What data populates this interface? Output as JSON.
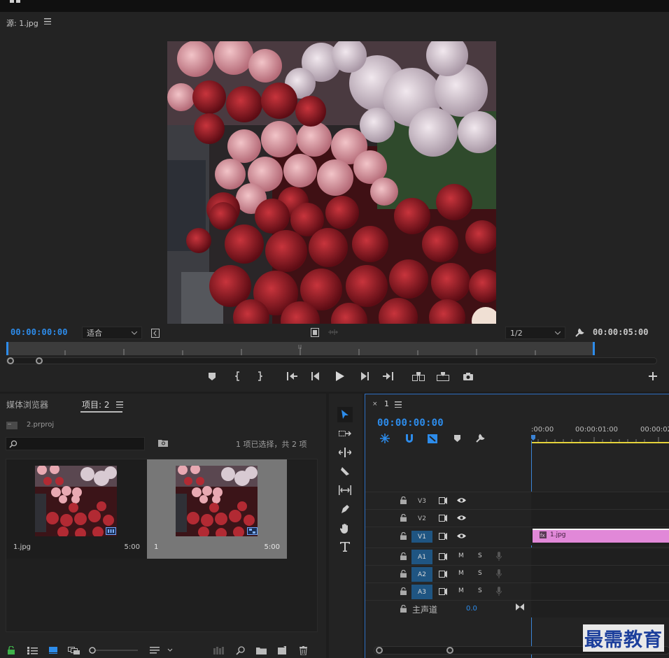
{
  "colors": {
    "accent": "#2d8ceb",
    "clip_pink": "#e188d8",
    "panel_bg": "#232323",
    "active_track": "#1f5582"
  },
  "source": {
    "title": "源: 1.jpg",
    "timecode": "00:00:00:00",
    "fit": "适合",
    "resolution": "1/2",
    "duration": "00:00:05:00",
    "image": "flower-market-photo"
  },
  "project": {
    "tab_media_browser": "媒体浏览器",
    "tab_project": "项目: 2",
    "project_file": "2.prproj",
    "selection_status": "1 项已选择，共 2 项",
    "clips": [
      {
        "name": "1.jpg",
        "duration": "5:00",
        "badge_icon": "still-image-badge-icon"
      },
      {
        "name": "1",
        "duration": "5:00",
        "badge_icon": "sequence-badge-icon"
      }
    ]
  },
  "timeline": {
    "sequence_tab": "1",
    "timecode": "00:00:00:00",
    "ruler_labels": [
      ":00:00",
      "00:00:01:00",
      "00:00:02"
    ],
    "tracks": {
      "video": [
        "V3",
        "V2",
        "V1"
      ],
      "audio": [
        "A1",
        "A2",
        "A3"
      ],
      "mute": "M",
      "solo": "S",
      "master": "主声道",
      "master_value": "0.0"
    },
    "clip_v1": "1.jpg"
  },
  "watermark": "最需教育"
}
